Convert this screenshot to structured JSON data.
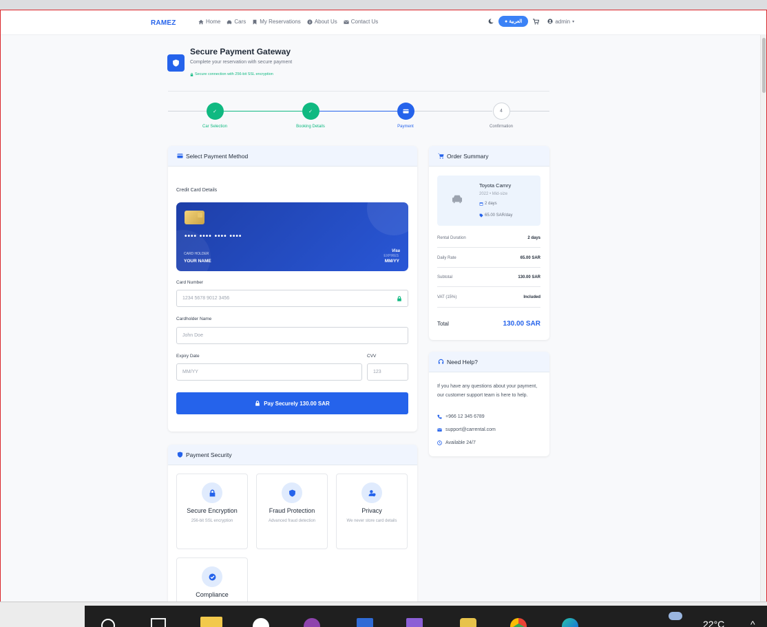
{
  "nav": {
    "brand": "RAMEZ",
    "links": [
      "Home",
      "Cars",
      "My Reservations",
      "About Us",
      "Contact Us"
    ],
    "lang_button": "العربية",
    "user": "admin"
  },
  "header": {
    "title": "Secure Payment Gateway",
    "subtitle": "Complete your reservation with secure payment",
    "secure_note": "Secure connection with 256-bit SSL encryption"
  },
  "steps": [
    {
      "label": "Car Selection",
      "state": "done"
    },
    {
      "label": "Booking Details",
      "state": "done"
    },
    {
      "label": "Payment",
      "state": "active"
    },
    {
      "label": "Confirmation",
      "state": "pending",
      "number": "4"
    }
  ],
  "payment": {
    "title": "Select Payment Method",
    "section_label": "Credit Card Details",
    "card_preview": {
      "number": "•••• •••• •••• ••••",
      "holder_label": "CARD HOLDER",
      "holder": "YOUR NAME",
      "brand_text": "Visa",
      "expires_label": "EXPIRES",
      "expiry": "MM/YY"
    },
    "card_number_label": "Card Number",
    "card_number_placeholder": "1234 5678 9012 3456",
    "cardholder_label": "Cardholder Name",
    "cardholder_placeholder": "John Doe",
    "expiry_label": "Expiry Date",
    "expiry_placeholder": "MM/YY",
    "cvv_label": "CVV",
    "cvv_placeholder": "123",
    "pay_button": "Pay Securely 130.00 SAR"
  },
  "security": {
    "title": "Payment Security",
    "items": [
      {
        "title": "Secure Encryption",
        "desc": "256-bit SSL encryption",
        "icon": "lock-icon"
      },
      {
        "title": "Fraud Protection",
        "desc": "Advanced fraud detection",
        "icon": "shield-icon"
      },
      {
        "title": "Privacy",
        "desc": "We never store card details",
        "icon": "user-shield-icon"
      },
      {
        "title": "Compliance",
        "desc": "",
        "icon": "check-circle-icon"
      }
    ]
  },
  "summary": {
    "title": "Order Summary",
    "car_name": "Toyota Camry",
    "car_meta": "2022 • Mid-size",
    "duration_badge": "2 days",
    "rate_badge": "65.00 SAR/day",
    "rows": [
      {
        "label": "Rental Duration",
        "value": "2 days"
      },
      {
        "label": "Daily Rate",
        "value": "65.00 SAR"
      },
      {
        "label": "Subtotal",
        "value": "130.00 SAR"
      },
      {
        "label": "VAT (15%)",
        "value": "Included"
      }
    ],
    "total_label": "Total",
    "total_value": "130.00 SAR"
  },
  "help": {
    "title": "Need Help?",
    "text": "If you have any questions about your payment, our customer support team is here to help.",
    "phone": "+966 12 345 6789",
    "email": "support@carrental.com",
    "hours": "Available 24/7"
  },
  "taskbar": {
    "temperature": "22°C"
  },
  "colors": {
    "primary": "#2563eb",
    "success": "#10b981",
    "danger_border": "#d9252a"
  }
}
